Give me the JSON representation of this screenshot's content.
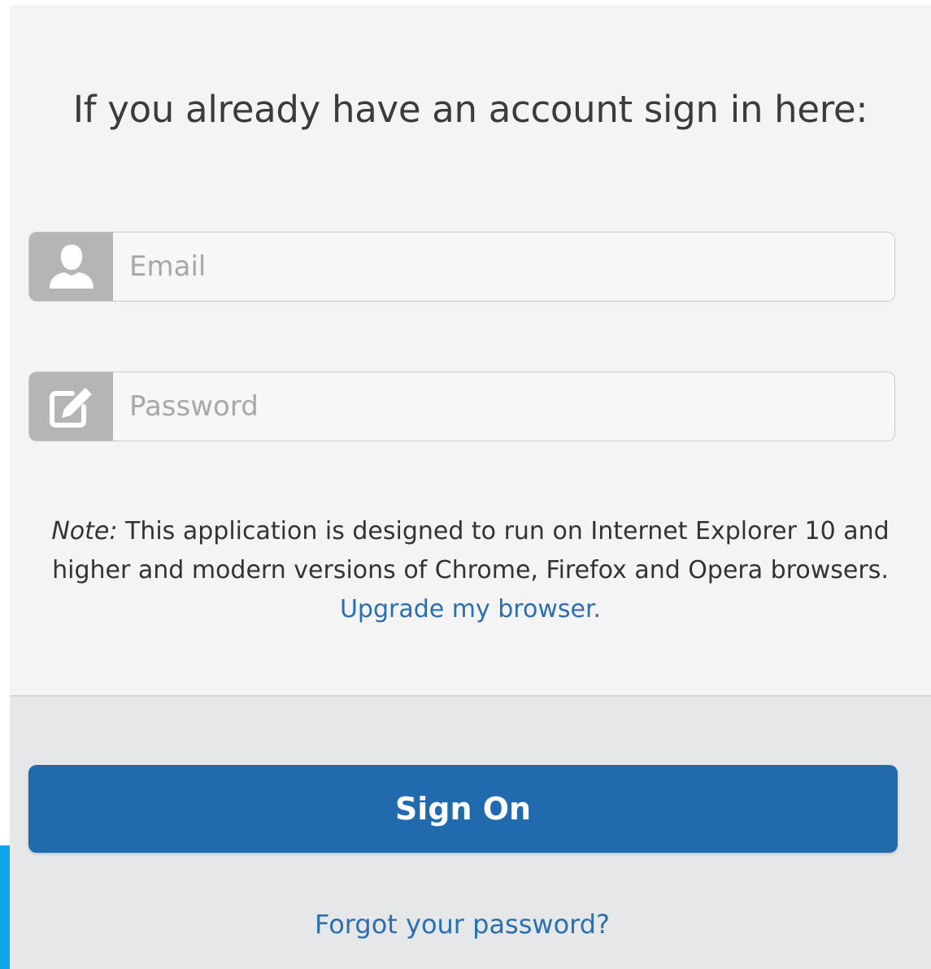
{
  "heading": "If you already have an account sign in here:",
  "form": {
    "email_placeholder": "Email",
    "email_icon": "user-icon",
    "password_placeholder": "Password",
    "password_icon": "edit-icon"
  },
  "note": {
    "label": "Note:",
    "text": " This application is designed to run on Internet Explorer 10 and higher and modern versions of Chrome, Firefox and Opera browsers.",
    "link": "Upgrade my browser."
  },
  "actions": {
    "sign_on_label": "Sign On",
    "forgot_label": "Forgot your password?"
  },
  "colors": {
    "primary": "#206aad",
    "link": "#2a6fb0",
    "accent": "#0ea5e9"
  }
}
